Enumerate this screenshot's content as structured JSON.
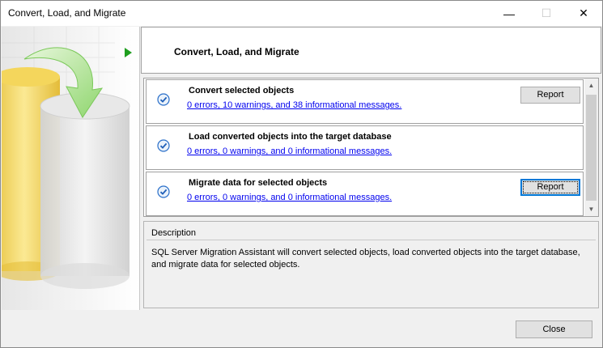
{
  "window": {
    "title": "Convert, Load, and Migrate",
    "minimize_glyph": "—",
    "maximize_glyph": "☐",
    "close_glyph": "✕"
  },
  "header": {
    "title": "Convert, Load, and Migrate"
  },
  "steps": [
    {
      "title": "Convert selected objects",
      "link": "0 errors, 10 warnings, and 38 informational messages.",
      "report_label": "Report",
      "status": "completed"
    },
    {
      "title": "Load converted objects into the target database",
      "link": "0 errors, 0 warnings, and 0 informational messages.",
      "status": "completed"
    },
    {
      "title": "Migrate data for selected objects",
      "link": "0 errors, 0 warnings, and 0 informational messages.",
      "report_label": "Report",
      "status": "completed"
    }
  ],
  "description": {
    "label": "Description",
    "text": "SQL Server Migration Assistant will convert selected objects, load converted objects into the target database, and migrate data for selected objects."
  },
  "footer": {
    "close_label": "Close"
  },
  "icons": {
    "check": "check-circle-icon",
    "nav": "play-arrow-icon",
    "art": "database-cylinders-illustration"
  },
  "colors": {
    "link": "#0000ee",
    "check": "#2a6fc9",
    "nav_arrow": "#1f9e1f",
    "focus": "#0078d7"
  }
}
